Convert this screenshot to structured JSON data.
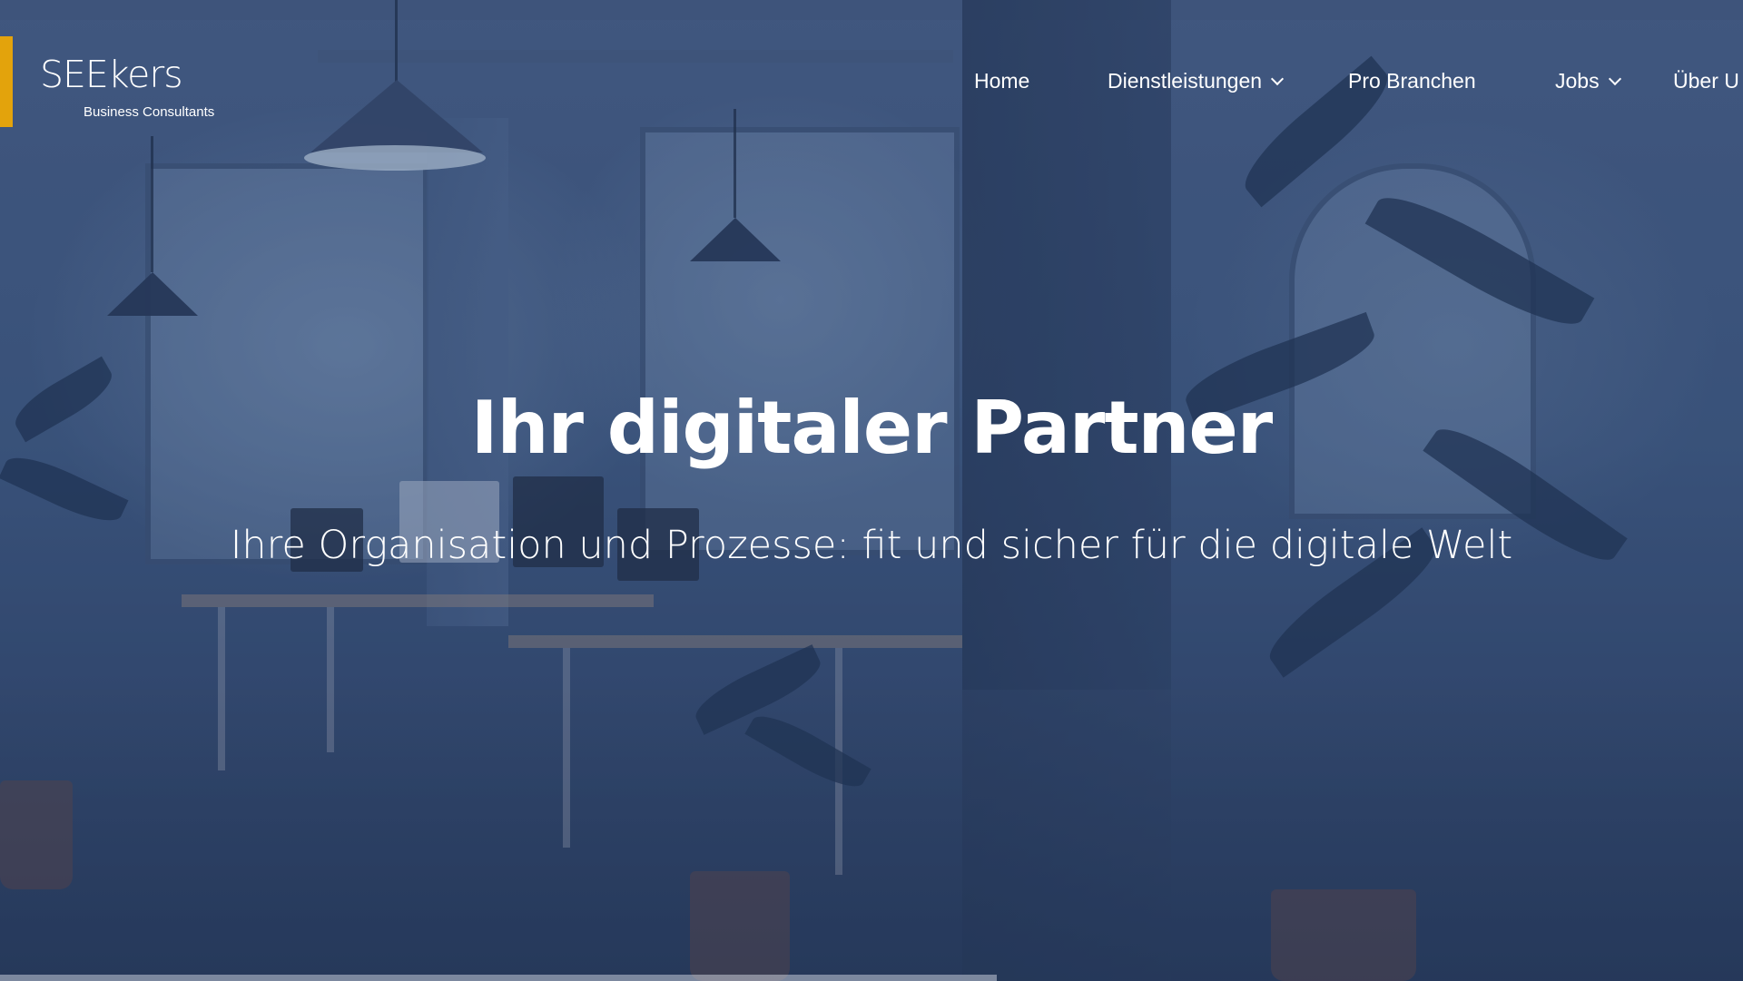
{
  "brand": {
    "name": "SEEkers",
    "tagline": "Business Consultants",
    "accent_color": "#e3a30c"
  },
  "nav": {
    "items": [
      {
        "label": "Home",
        "has_dropdown": false
      },
      {
        "label": "Dienstleistungen",
        "has_dropdown": true
      },
      {
        "label": "Pro Branchen",
        "has_dropdown": false
      },
      {
        "label": "Jobs",
        "has_dropdown": true
      },
      {
        "label": "Über U",
        "has_dropdown": false
      }
    ]
  },
  "hero": {
    "title": "Ihr digitaler Partner",
    "subtitle": "Ihre Organisation und Prozesse: fit und sicher für die digitale Welt",
    "overlay_color": "#2c4265"
  }
}
